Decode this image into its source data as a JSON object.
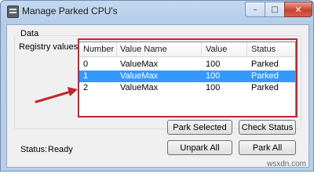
{
  "window": {
    "title": "Manage Parked CPU's",
    "controls": {
      "minimize": "–",
      "maximize": "□",
      "close": "✕"
    }
  },
  "group": {
    "label": "Data",
    "registry_label": "Registry values:"
  },
  "table": {
    "columns": [
      "Number",
      "Value Name",
      "Value",
      "Status"
    ],
    "rows": [
      {
        "number": "0",
        "name": "ValueMax",
        "value": "100",
        "status": "Parked",
        "selected": false
      },
      {
        "number": "1",
        "name": "ValueMax",
        "value": "100",
        "status": "Parked",
        "selected": true
      },
      {
        "number": "2",
        "name": "ValueMax",
        "value": "100",
        "status": "Parked",
        "selected": false
      }
    ]
  },
  "buttons": {
    "park_selected": "Park Selected",
    "check_status": "Check Status",
    "unpark_all": "Unpark All",
    "park_all": "Park All"
  },
  "status": {
    "label": "Status:",
    "value": "Ready"
  },
  "watermark": "wsxdn.com",
  "colors": {
    "selection": "#3399ff",
    "highlight_box": "#c0272d",
    "arrow": "#c0272d"
  }
}
